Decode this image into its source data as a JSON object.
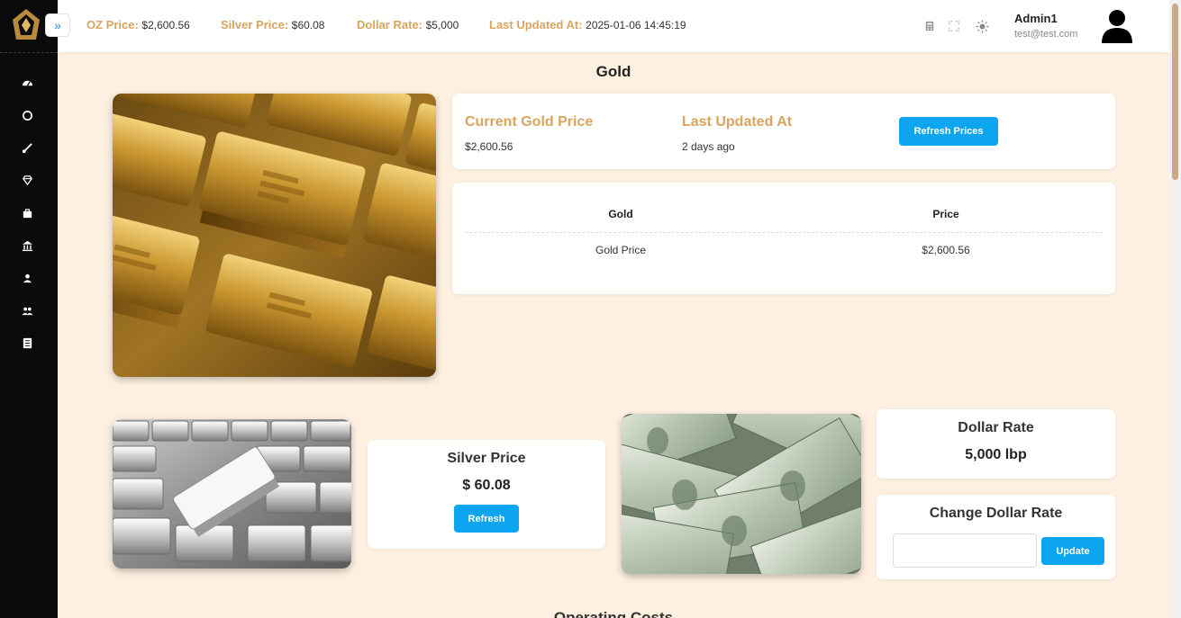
{
  "header": {
    "expand_icon": "»",
    "tickers": [
      {
        "label": "OZ Price:",
        "value": "$2,600.56"
      },
      {
        "label": "Silver Price:",
        "value": "$60.08"
      },
      {
        "label": "Dollar Rate:",
        "value": "$5,000"
      },
      {
        "label": "Last Updated At:",
        "value": "2025-01-06 14:45:19"
      }
    ],
    "icons": [
      "calculator-icon",
      "fullscreen-icon",
      "sun-icon"
    ],
    "user": {
      "name": "Admin1",
      "email": "test@test.com"
    }
  },
  "sidebar": {
    "icons": [
      "dashboard-icon",
      "circle-icon",
      "brush-icon",
      "diamond-icon",
      "briefcase-icon",
      "bank-icon",
      "user-icon",
      "users-icon",
      "document-icon"
    ]
  },
  "page": {
    "title": "Gold"
  },
  "gold": {
    "current_price_label": "Current Gold Price",
    "current_price_value": "$2,600.56",
    "last_updated_label": "Last Updated At",
    "last_updated_value": "2 days ago",
    "refresh_button": "Refresh Prices",
    "table": {
      "headers": [
        "Gold",
        "Price"
      ],
      "rows": [
        [
          "Gold Price",
          "$2,600.56"
        ]
      ]
    }
  },
  "silver": {
    "title": "Silver Price",
    "value": "$ 60.08",
    "refresh_button": "Refresh"
  },
  "dollar": {
    "rate_title": "Dollar Rate",
    "rate_value": "5,000 lbp",
    "change_title": "Change Dollar Rate",
    "input_value": "",
    "update_button": "Update"
  },
  "next_section_title": "Operating Costs",
  "colors": {
    "accent_gold": "#d9a45e",
    "button_blue": "#0ea5f0",
    "page_bg": "#fdf0e0",
    "sidebar_bg": "#0b0b0b"
  }
}
